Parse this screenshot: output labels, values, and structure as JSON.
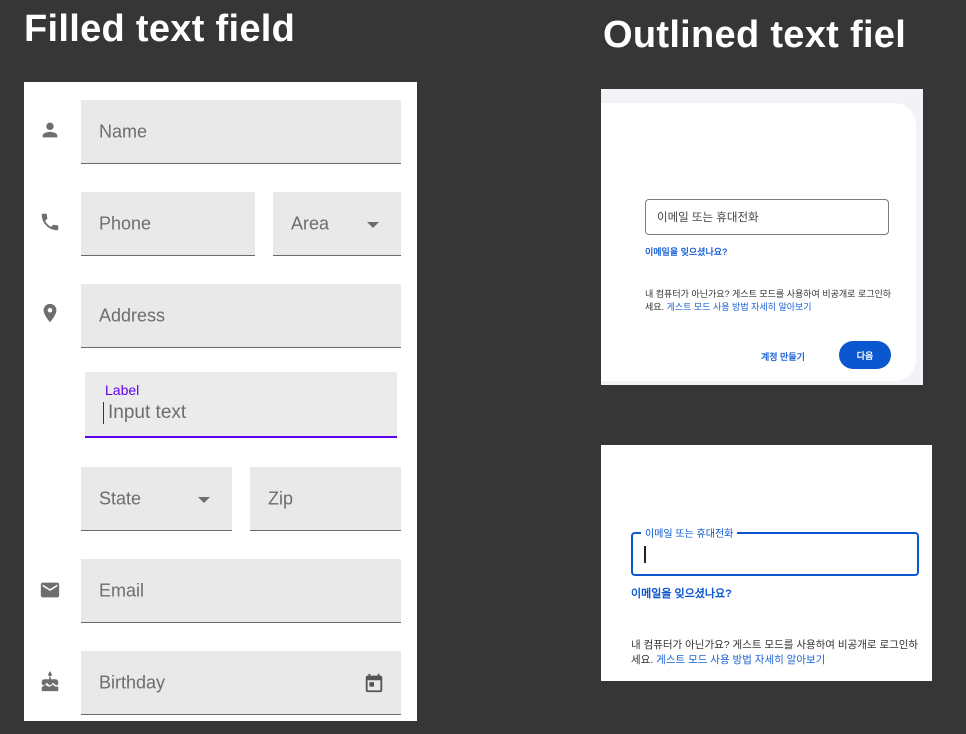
{
  "titles": {
    "filled": "Filled text field",
    "outlined": "Outlined text fiel"
  },
  "filled_form": {
    "name_placeholder": "Name",
    "phone_placeholder": "Phone",
    "area_placeholder": "Area",
    "address_placeholder": "Address",
    "active_field": {
      "label": "Label",
      "value": "Input text"
    },
    "state_placeholder": "State",
    "zip_placeholder": "Zip",
    "email_placeholder": "Email",
    "birthday_placeholder": "Birthday",
    "accent_color": "#6200ee",
    "icons": [
      "person-icon",
      "phone-icon",
      "location-pin-icon",
      "mail-icon",
      "cake-icon",
      "calendar-icon",
      "dropdown-arrow-icon"
    ]
  },
  "outlined_form_default": {
    "input_placeholder": "이메일 또는 휴대전화",
    "forgot_email": "이메일을 잊으셨나요?",
    "guest_text": "내 컴퓨터가 아닌가요? 게스트 모드를 사용하여 비공개로 로그인하세요.",
    "guest_link": "게스트 모드 사용 방법 자세히 알아보기",
    "create_account": "계정 만들기",
    "next_button": "다음",
    "accent_color": "#0b57d0"
  },
  "outlined_form_focused": {
    "floating_label": "이메일 또는 휴대전화",
    "input_value": "",
    "forgot_email": "이메일을 잊으셨나요?",
    "guest_text": "내 컴퓨터가 아닌가요? 게스트 모드를 사용하여 비공개로 로그인하세요.",
    "guest_link": "게스트 모드 사용 방법 자세히 알아보기"
  }
}
